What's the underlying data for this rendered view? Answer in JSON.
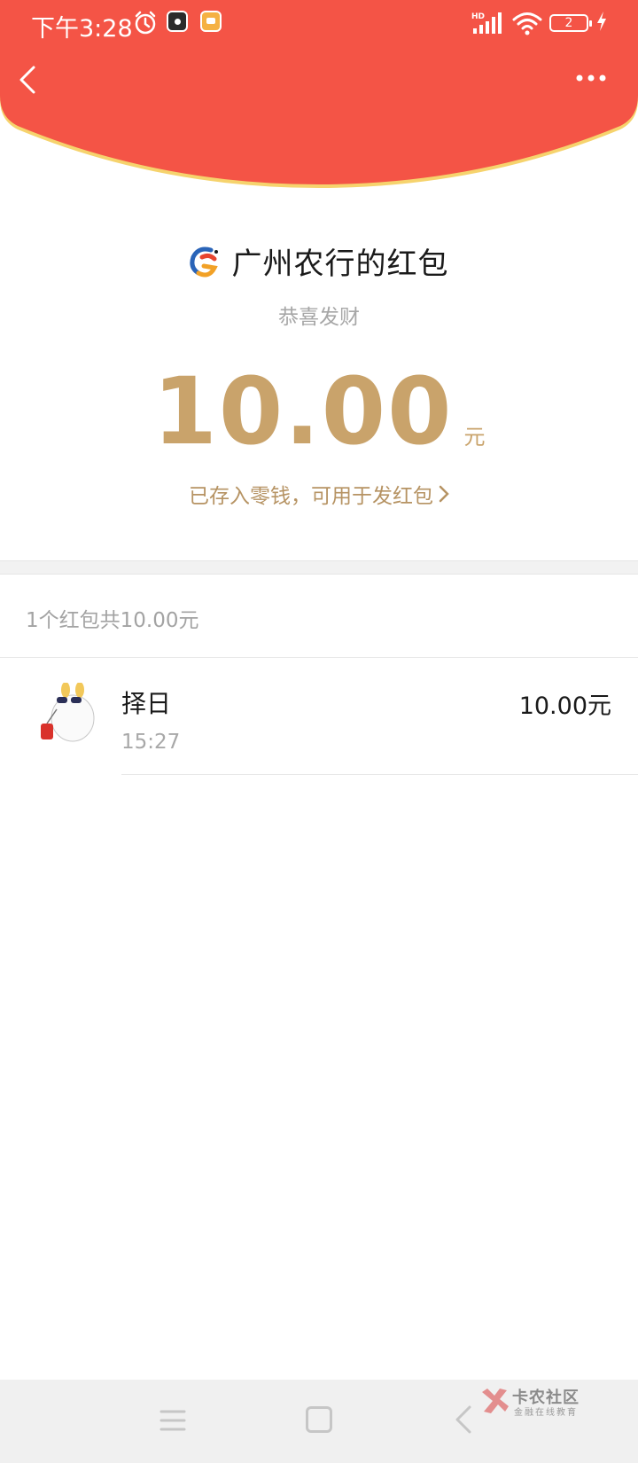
{
  "status_bar": {
    "time": "下午3:28",
    "battery": "2"
  },
  "header": {
    "color": "#f45446",
    "accent": "#f6d36d"
  },
  "packet": {
    "title": "广州农行的红包",
    "wish": "恭喜发财",
    "amount": "10.00",
    "unit": "元",
    "saved_note": "已存入零钱，可用于发红包",
    "amount_color": "#c9a36b"
  },
  "summary": {
    "text": "1个红包共10.00元"
  },
  "records": [
    {
      "name": "择日",
      "time": "15:27",
      "amount": "10.00元"
    }
  ],
  "watermark": {
    "title": "卡农社区",
    "subtitle": "金融在线教育"
  },
  "icons": {
    "back": "back-chevron-icon",
    "more": "more-dots-icon",
    "alarm": "alarm-clock-icon",
    "wifi": "wifi-icon",
    "signal": "signal-hd-icon",
    "battery": "battery-icon",
    "charge": "charging-bolt-icon",
    "logo": "bank-logo-icon",
    "nav_menu": "menu-icon",
    "nav_home": "home-square-icon",
    "nav_back": "nav-back-icon"
  }
}
